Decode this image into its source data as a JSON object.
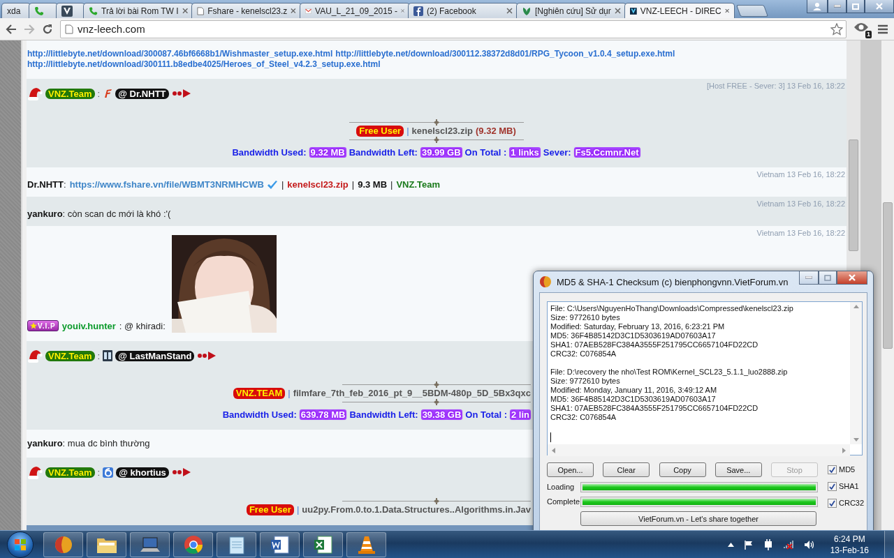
{
  "browser": {
    "tabs": [
      {
        "title": "xda",
        "selected": false
      },
      {
        "kind": "phone",
        "selected": false
      },
      {
        "kind": "v-logo",
        "selected": false
      },
      {
        "kind": "phone",
        "title": "Trả lời bài Rom TW I",
        "selected": false
      },
      {
        "kind": "page",
        "title": "Fshare - kenelscl23.z",
        "selected": false
      },
      {
        "kind": "mail",
        "title": "VAU_L_21_09_2015 -",
        "selected": false
      },
      {
        "kind": "facebook",
        "title": "(2) Facebook",
        "selected": false
      },
      {
        "kind": "leaf",
        "title": "[Nghiên cứu] Sử dụr",
        "selected": false
      },
      {
        "kind": "vnz",
        "title": "VNZ-LEECH - DIREC",
        "selected": true
      }
    ],
    "address": "vnz-leech.com",
    "extension_badge": "1"
  },
  "chat": {
    "messages": [
      {
        "kind": "links",
        "lines": [
          [
            "http://littlebyte.net/download/300087.46bf6668b1/Wishmaster_setup.exe.html",
            "http://littlebyte.net/download/300112.38372d8d01/RPG_Tycoon_v1.0.4_setup.exe.html"
          ],
          [
            "http://littlebyte.net/download/300111.b8edbe4025/Heroes_of_Steel_v4.2.3_setup.exe.html"
          ]
        ]
      },
      {
        "kind": "bot",
        "sender": "VNZ.Team",
        "colon": ":",
        "mention": {
          "kind": "flame",
          "text": "@ Dr.NHTT"
        },
        "time": "[Host FREE - Sever: 3] 13 Feb 16, 18:22",
        "cut_off": false,
        "tag": "Free User",
        "bar": "|",
        "file": "kenelscl23.zip",
        "size": "(9.32 MB)",
        "stats": [
          {
            "label": "Bandwidth Used:",
            "value": "9.32 MB"
          },
          {
            "label": "Bandwidth Left:",
            "value": "39.99 GB"
          },
          {
            "label": "On Total :",
            "value": "1 links"
          },
          {
            "label": "Sever:",
            "value": "Fs5.Ccmnr.Net"
          }
        ]
      },
      {
        "kind": "text",
        "author": "Dr.NHTT",
        "time": "Vietnam 13 Feb 16, 18:22",
        "parts": [
          {
            "kind": "plain",
            "text": ":"
          },
          {
            "kind": "link",
            "text": "https://www.fshare.vn/file/WBMT3NRMHCWB"
          },
          {
            "kind": "verified"
          },
          {
            "kind": "plain",
            "text": "|"
          },
          {
            "kind": "file",
            "text": "kenelscl23.zip"
          },
          {
            "kind": "plain",
            "text": "|"
          },
          {
            "kind": "size",
            "text": "9.3 MB"
          },
          {
            "kind": "plain",
            "text": "|"
          },
          {
            "kind": "team",
            "text": "VNZ.Team"
          }
        ]
      },
      {
        "kind": "text",
        "author": "yankuro",
        "time": "Vietnam 13 Feb 16, 18:22",
        "parts": [
          {
            "kind": "plain",
            "text": ": còn scan dc mới là khó :'("
          }
        ]
      },
      {
        "badge": "V.I.P",
        "author": "youiv.hunter",
        "text": ": @ khiradi:",
        "time": "Vietnam 13 Feb 16, 18:22"
      },
      {
        "kind": "bot",
        "sender": "VNZ.Team",
        "colon": ":",
        "mention": {
          "kind": "tiles",
          "text": "@ LastManStand"
        },
        "cut_off": true,
        "tag": "VNZ.TEAM",
        "bar": "|",
        "file": "filmfare_7th_feb_2016_pt_9__5BDM-480p_5D_5Bx3qxc",
        "stats": [
          {
            "label": "Bandwidth Used:",
            "value": "639.78 MB"
          },
          {
            "label": "Bandwidth Left:",
            "value": "39.38 GB"
          },
          {
            "label": "On Total :",
            "value": "2 lin"
          }
        ]
      },
      {
        "kind": "text",
        "author": "yankuro",
        "parts": [
          {
            "kind": "plain",
            "text": ": mua dc bình thường"
          }
        ]
      },
      {
        "kind": "bot",
        "sender": "VNZ.Team",
        "colon": ":",
        "mention": {
          "kind": "ring",
          "text": "@ khortius"
        },
        "cut_off": true,
        "tag": "Free User",
        "bar": "|",
        "file": "uu2py.From.0.to.1.Data.Structures..Algorithms.in.Jav"
      }
    ]
  },
  "checksum_window": {
    "title": "MD5 & SHA-1 Checksum (c) bienphongvnn.VietForum.vn",
    "records": [
      [
        "File: C:\\Users\\NguyenHoThang\\Downloads\\Compressed\\kenelscl23.zip",
        "Size: 9772610 bytes",
        "Modified: Saturday, February 13, 2016, 6:23:21 PM",
        "MD5: 36F4B85142D3C1D5303619AD07603A17",
        "SHA1: 07AEB528FC384A3555F251795CC6657104FD22CD",
        "CRC32: C076854A"
      ],
      [
        "File: D:\\recovery the nho\\Test ROM\\Kernel_SCL23_5.1.1_luo2888.zip",
        "Size: 9772610 bytes",
        "Modified: Monday, January 11, 2016, 3:49:12 AM",
        "MD5: 36F4B85142D3C1D5303619AD07603A17",
        "SHA1: 07AEB528FC384A3555F251795CC6657104FD22CD",
        "CRC32: C076854A"
      ]
    ],
    "buttons": [
      {
        "label": "Open...",
        "disabled": false
      },
      {
        "label": "Clear",
        "disabled": false
      },
      {
        "label": "Copy",
        "disabled": false
      },
      {
        "label": "Save...",
        "disabled": false
      },
      {
        "label": "Stop",
        "disabled": true
      }
    ],
    "options": [
      {
        "label": "MD5",
        "checked": true
      },
      {
        "label": "SHA1",
        "checked": true
      },
      {
        "label": "CRC32",
        "checked": true
      }
    ],
    "progress": [
      {
        "label": "Loading",
        "level": 1
      },
      {
        "label": "Complete",
        "level": 1
      }
    ],
    "footer_button": "VietForum.vn - Let's share together"
  },
  "taskbar": {
    "apps": [
      {
        "kind": "ball"
      },
      {
        "kind": "folder"
      },
      {
        "kind": "laptop"
      },
      {
        "kind": "chrome"
      },
      {
        "kind": "notepad"
      },
      {
        "kind": "word"
      },
      {
        "kind": "excel"
      },
      {
        "kind": "cone"
      }
    ],
    "clock": {
      "time": "6:24 PM",
      "date": "13-Feb-16"
    }
  }
}
